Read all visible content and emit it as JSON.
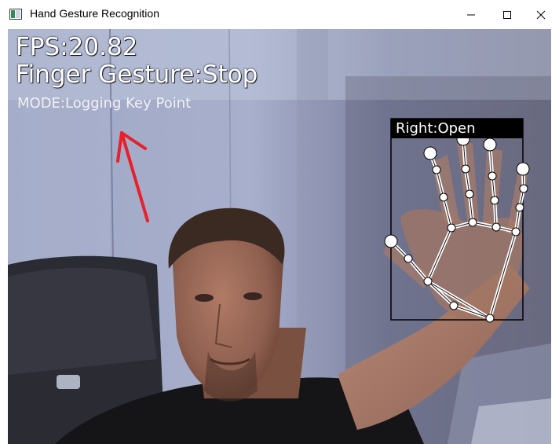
{
  "window": {
    "title": "Hand Gesture Recognition",
    "controls": [
      "minimize-icon",
      "maximize-icon",
      "close-icon"
    ]
  },
  "overlay": {
    "fps": "FPS:20.82",
    "finger_gesture": "Finger Gesture:Stop",
    "mode": "MODE:Logging Key Point"
  },
  "hand": {
    "label": "Right:Open"
  },
  "colors": {
    "arrow": "#e8202a",
    "overlay_text": "#ffffff",
    "label_background": "#000000"
  }
}
